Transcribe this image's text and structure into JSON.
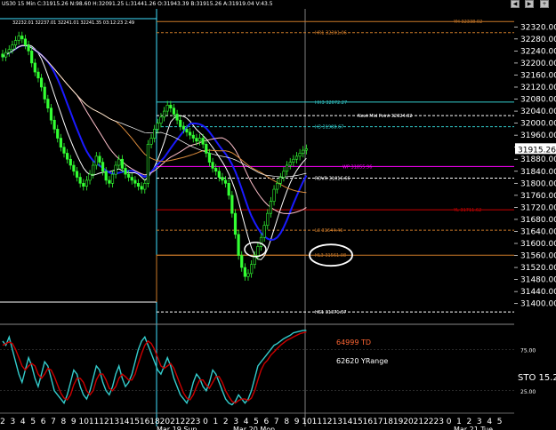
{
  "header": {
    "text": "US30  15 Min  C:31915.26  N:98.60  H:32091.25  L:31441.26  O:31943.39  B:31915.26  A:31919.04  V:43.5",
    "subtext": "32232.01  32237.01  32241.01  32241.35  03:12:23  2:49"
  },
  "colors": {
    "background": "#000000",
    "candle": "#33ff33",
    "blue_ma": "#1a1aff",
    "white_ma": "#ffffff",
    "orange_ma": "#d98a3c",
    "pink_ma": "#ffc0cb",
    "magenta": "#ff00ff",
    "cyan": "#33cccc",
    "orange_level": "#cc7a29",
    "red_level": "#cc0000",
    "stoch_k": "#33cccc",
    "stoch_d": "#cc0000",
    "axis_text": "#ffffff",
    "highlight_circle": "#ffffff"
  },
  "price_labels": {
    "current": "31915.26"
  },
  "annotations": {
    "stoch_td": "64999 TD",
    "stoch_yrange": "62620 YRange",
    "stoch_label": "STO  15.2"
  },
  "levels": [
    {
      "label": "YH 32338.02",
      "price": 32338,
      "color": "#cc7a29",
      "style": "solid"
    },
    {
      "label": "HR1 32301.06",
      "price": 32301,
      "color": "#cc7a29",
      "style": "dashed"
    },
    {
      "label": "HH3 32072.27",
      "price": 32070,
      "color": "#33cccc",
      "style": "solid"
    },
    {
      "label": "Next Mid Point 32024.92",
      "price": 32025,
      "color": "#ffffff",
      "style": "dashed"
    },
    {
      "label": "H3 31988.67",
      "price": 31988,
      "color": "#33cccc",
      "style": "dashed"
    },
    {
      "label": "WP 31855.96",
      "price": 31856,
      "color": "#ff00ff",
      "style": "solid"
    },
    {
      "label": "RDVR 31816.66",
      "price": 31817,
      "color": "#ffffff",
      "style": "dashed"
    },
    {
      "label": "YL 31711.62",
      "price": 31712,
      "color": "#cc0000",
      "style": "solid"
    },
    {
      "label": "L3 31644.46",
      "price": 31644,
      "color": "#cc7a29",
      "style": "dashed"
    },
    {
      "label": "HL3 31561.08",
      "price": 31561,
      "color": "#cc7a29",
      "style": "solid"
    },
    {
      "label": "HS1 31371.57",
      "price": 31372,
      "color": "#ffffff",
      "style": "dashed"
    }
  ],
  "chart_data": {
    "type": "candlestick",
    "title": "US30 15 Min",
    "ylim": [
      31340,
      32380
    ],
    "yticks": [
      "32320.00",
      "32280.00",
      "32240.00",
      "32200.00",
      "32160.00",
      "32120.00",
      "32080.00",
      "32040.00",
      "32000.00",
      "31960.00",
      "31920.00",
      "31880.00",
      "31840.00",
      "31800.00",
      "31760.00",
      "31720.00",
      "31680.00",
      "31640.00",
      "31600.00",
      "31560.00",
      "31520.00",
      "31480.00",
      "31440.00",
      "31400.00"
    ],
    "stoch_ticks": [
      "75.00",
      "25.00"
    ],
    "xticks": [
      "2",
      "3",
      "4",
      "5",
      "6",
      "7",
      "8",
      "9",
      "10",
      "11",
      "12",
      "13",
      "14",
      "15",
      "16",
      "18",
      "20",
      "21",
      "22",
      "23",
      "0",
      "1",
      "2",
      "3",
      "4",
      "5",
      "6",
      "7",
      "8",
      "9",
      "10",
      "11",
      "12",
      "13",
      "14",
      "15",
      "16",
      "17",
      "18",
      "19",
      "20",
      "21",
      "22",
      "23",
      "0",
      "1",
      "2",
      "3",
      "4",
      "5"
    ],
    "date_labels": [
      "Mar 19 Sun",
      "Mar 20 Mon",
      "Mar 21 Tue"
    ],
    "closes": [
      32220,
      32235,
      32245,
      32260,
      32275,
      32290,
      32280,
      32260,
      32240,
      32200,
      32170,
      32150,
      32120,
      32080,
      32050,
      32010,
      31980,
      31950,
      31920,
      31900,
      31880,
      31860,
      31840,
      31820,
      31800,
      31790,
      31810,
      31830,
      31860,
      31890,
      31870,
      31840,
      31810,
      31800,
      31830,
      31860,
      31880,
      31850,
      31830,
      31820,
      31810,
      31800,
      31790,
      31780,
      31800,
      31930,
      31950,
      31980,
      32000,
      32020,
      32040,
      32060,
      32050,
      32030,
      32010,
      31990,
      31980,
      31970,
      31960,
      31950,
      31940,
      31950,
      31930,
      31900,
      31870,
      31850,
      31840,
      31820,
      31810,
      31800,
      31760,
      31700,
      31630,
      31560,
      31520,
      31490,
      31500,
      31530,
      31560,
      31590,
      31620,
      31660,
      31700,
      31740,
      31780,
      31800,
      31820,
      31840,
      31860,
      31870,
      31880,
      31890,
      31900,
      31910,
      31915
    ],
    "stoch_k": [
      85,
      80,
      90,
      75,
      60,
      45,
      35,
      50,
      65,
      55,
      40,
      30,
      45,
      60,
      55,
      40,
      25,
      20,
      15,
      10,
      20,
      35,
      50,
      45,
      30,
      20,
      15,
      25,
      40,
      55,
      50,
      35,
      25,
      20,
      30,
      45,
      55,
      40,
      30,
      35,
      45,
      60,
      75,
      85,
      90,
      80,
      70,
      60,
      50,
      45,
      55,
      65,
      55,
      40,
      30,
      20,
      15,
      10,
      20,
      35,
      45,
      40,
      30,
      25,
      35,
      50,
      45,
      35,
      25,
      15,
      10,
      8,
      12,
      20,
      15,
      10,
      15,
      25,
      40,
      55,
      60,
      65,
      70,
      75,
      80,
      82,
      85,
      88,
      90,
      92,
      95,
      96,
      97,
      98,
      98
    ],
    "stoch_d": [
      80,
      82,
      84,
      82,
      75,
      65,
      55,
      50,
      55,
      58,
      55,
      45,
      40,
      45,
      52,
      50,
      42,
      32,
      22,
      16,
      14,
      20,
      32,
      40,
      40,
      35,
      25,
      20,
      25,
      38,
      45,
      45,
      38,
      28,
      25,
      30,
      40,
      45,
      42,
      38,
      38,
      45,
      58,
      70,
      80,
      85,
      82,
      75,
      65,
      55,
      52,
      55,
      58,
      52,
      42,
      32,
      22,
      16,
      14,
      20,
      30,
      38,
      38,
      32,
      28,
      35,
      42,
      42,
      35,
      25,
      18,
      12,
      10,
      13,
      15,
      15,
      13,
      16,
      25,
      38,
      50,
      58,
      62,
      68,
      72,
      76,
      80,
      83,
      86,
      88,
      90,
      92,
      94,
      95,
      96
    ]
  }
}
